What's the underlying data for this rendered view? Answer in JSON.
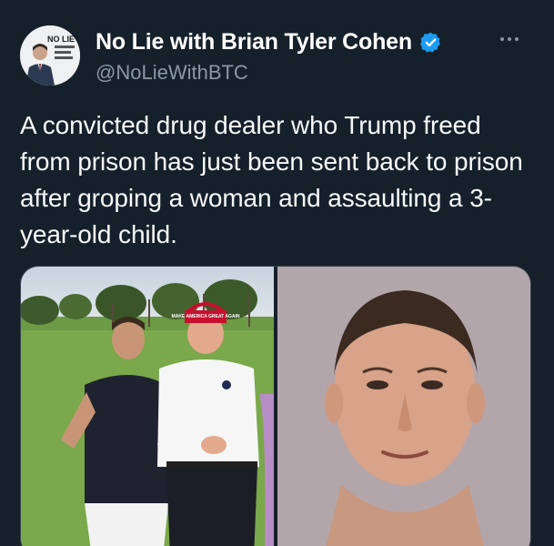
{
  "author": {
    "display_name": "No Lie with Brian Tyler Cohen",
    "handle": "@NoLieWithBTC",
    "avatar_text": "NO LIE",
    "verified_color": "#1d9bf0"
  },
  "tweet": {
    "text": "A convicted drug dealer who Trump freed from prison has just been sent back to prison after groping a woman and assaulting a 3-year-old child."
  },
  "media": {
    "left_photo_hat_text": "MAKE AMERICA GREAT AGAIN"
  },
  "colors": {
    "background": "#15202b",
    "text": "#f7f9f9",
    "secondary_text": "#8b98a5"
  },
  "icons": {
    "verified": "verified-badge-icon",
    "more": "more-options-icon"
  }
}
